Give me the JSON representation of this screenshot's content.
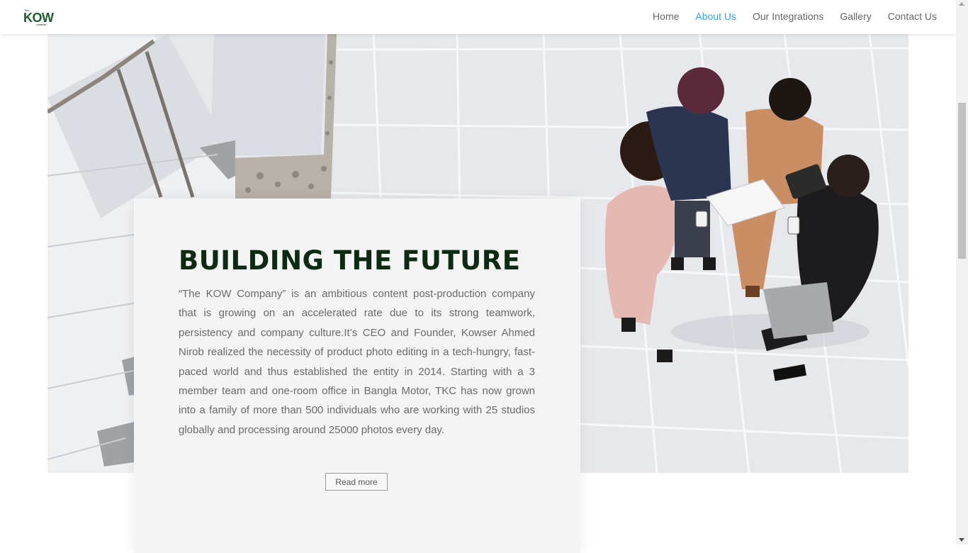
{
  "header": {
    "logo": {
      "top_text": "The",
      "main_text": "KOW",
      "sub_text": "COMPANY"
    },
    "nav": [
      {
        "label": "Home",
        "active": false
      },
      {
        "label": "About Us",
        "active": true
      },
      {
        "label": "Our Integrations",
        "active": false
      },
      {
        "label": "Gallery",
        "active": false
      },
      {
        "label": "Contact Us",
        "active": false
      }
    ]
  },
  "hero": {
    "image_icon": "office-team-meeting-photo"
  },
  "card": {
    "title": "BUILDING THE FUTURE",
    "body": "“The KOW Company” is an ambitious content post-production company that is growing on an accelerated rate due to its strong teamwork, persistency and company culture.It’s CEO and Founder, Kowser Ahmed Nirob realized the necessity of product photo editing in a tech-hungry, fast-paced world and thus established the entity in 2014. Starting with a 3 member team and one-room office in Bangla Motor, TKC has now grown into a family of more than 500 individuals who are working with 25 studios globally and processing around 25000 photos every day.",
    "button_label": "Read more"
  },
  "colors": {
    "accent": "#2ea3f2",
    "title": "#0c2b12",
    "logo": "#1f5c2d"
  }
}
